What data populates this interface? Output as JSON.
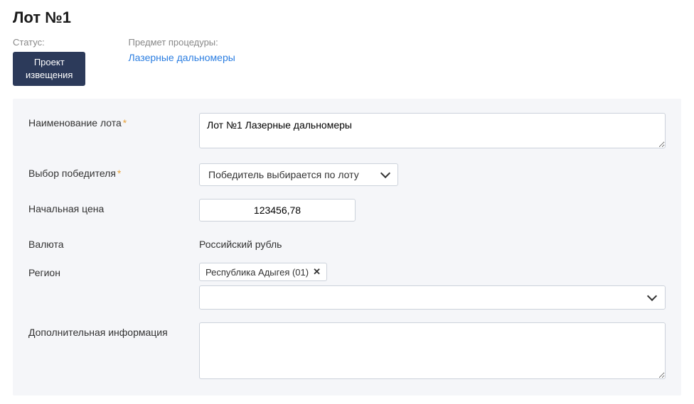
{
  "title": "Лот №1",
  "header": {
    "status_label": "Статус:",
    "status_value": "Проект\nизвещения",
    "subject_label": "Предмет процедуры:",
    "subject_value": "Лазерные дальномеры"
  },
  "form": {
    "lot_name_label": "Наименование лота",
    "lot_name_value": "Лот №1 Лазерные дальномеры",
    "winner_label": "Выбор победителя",
    "winner_value": "Победитель выбирается по лоту",
    "price_label": "Начальная цена",
    "price_value": "123456,78",
    "currency_label": "Валюта",
    "currency_value": "Российский рубль",
    "region_label": "Регион",
    "region_tag": "Республика Адыгея (01)",
    "region_select_value": "",
    "extra_label": "Дополнительная информация",
    "extra_value": ""
  }
}
